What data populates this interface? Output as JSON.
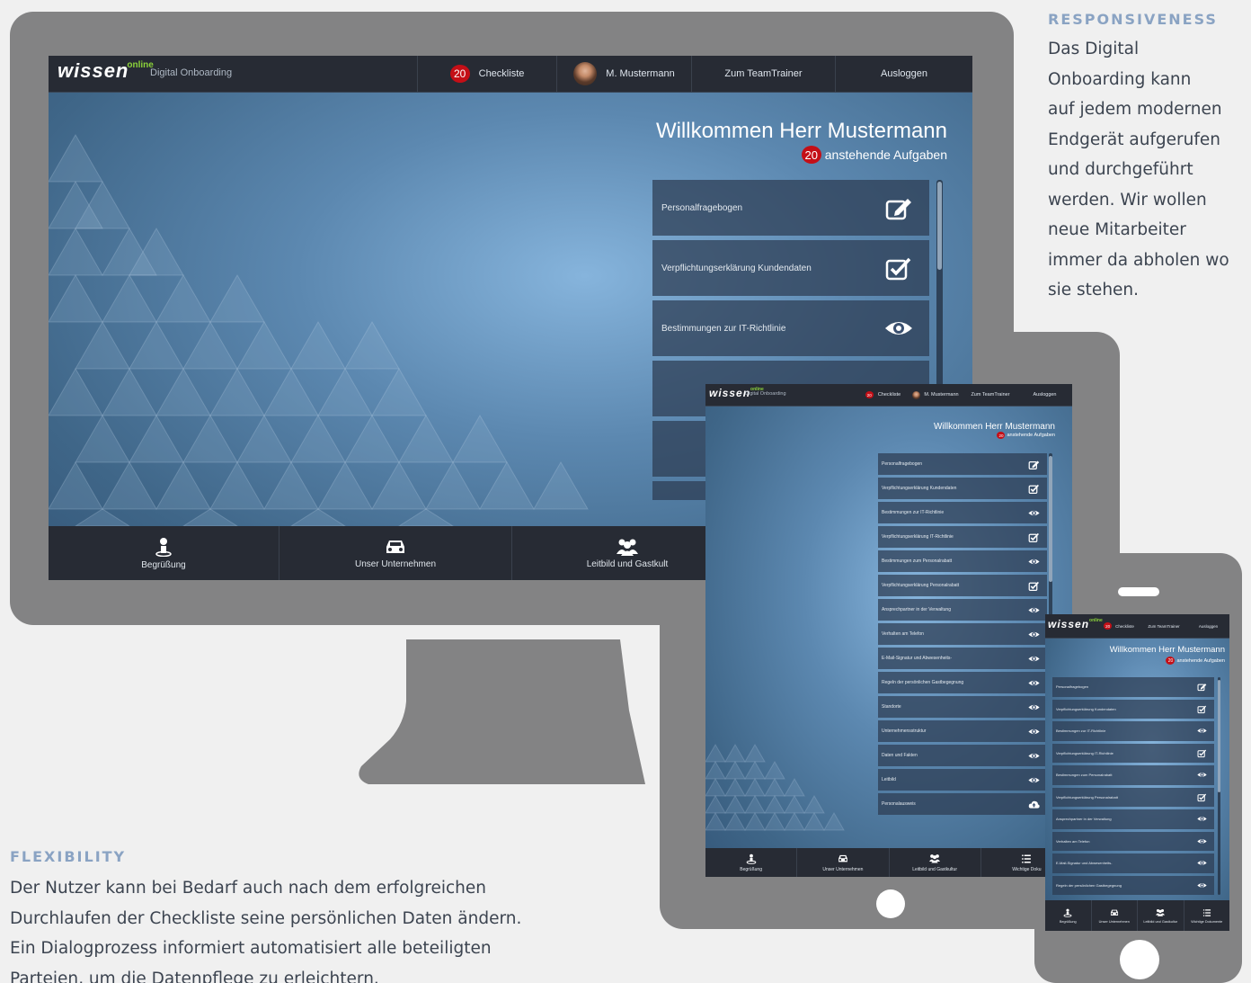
{
  "app": {
    "logo_brand": "wissen",
    "logo_sub": "online",
    "product": "Digital Onboarding",
    "badge_count": "20",
    "checklist_label": "Checkliste",
    "user_name": "M. Mustermann",
    "teamtrainer_label": "Zum TeamTrainer",
    "logout_label": "Ausloggen",
    "welcome_title": "Willkommen Herr Mustermann",
    "pending_label": "anstehende Aufgaben",
    "tasks": [
      {
        "label": "Personalfragebogen",
        "icon": "edit-icon"
      },
      {
        "label": "Verpflichtungserklärung Kundendaten",
        "icon": "check-square-icon"
      },
      {
        "label": "Bestimmungen zur IT-Richtlinie",
        "icon": "eye-icon"
      },
      {
        "label": "Verpflichtungserklärung IT-Richtlinie",
        "icon": "check-square-icon"
      },
      {
        "label": "Bestimmungen zum Personalrabatt",
        "icon": "eye-icon"
      },
      {
        "label": "Verpflichtungserklärung Personalrabatt",
        "icon": "check-square-icon"
      },
      {
        "label": "Ansprechpartner in der Verwaltung",
        "icon": "eye-icon"
      },
      {
        "label": "Verhalten am Telefon",
        "icon": "eye-icon"
      },
      {
        "label": "E-Mail-Signatur und Abwesenheits-",
        "icon": "eye-icon"
      },
      {
        "label": "Regeln der persönlichen Gastbegegnung",
        "icon": "eye-icon"
      },
      {
        "label": "Standorte",
        "icon": "eye-icon"
      },
      {
        "label": "Unternehmensstruktur",
        "icon": "eye-icon"
      },
      {
        "label": "Daten und Fakten",
        "icon": "eye-icon"
      },
      {
        "label": "Leitbild",
        "icon": "eye-icon"
      },
      {
        "label": "Personalausweis",
        "icon": "cloud-upload-icon"
      }
    ],
    "bottom_nav": [
      {
        "label": "Begrüßung",
        "icon": "person-pin-icon"
      },
      {
        "label": "Unser Unternehmen",
        "icon": "car-icon"
      },
      {
        "label": "Leitbild und Gastkultur",
        "icon": "group-icon"
      },
      {
        "label": "Wichtige Dokumente",
        "icon": "list-icon"
      }
    ],
    "desktop_bottom_nav": [
      "Begrüßung",
      "Unser Unternehmen",
      "Leitbild und Gastkult"
    ],
    "tablet_bottom_last": "Wichtige Doku"
  },
  "sidebar": {
    "heading": "RESPONSIVENESS",
    "lines": [
      "Das Digital",
      "Onboarding kann",
      "auf jedem modernen",
      "Endgerät aufgerufen",
      "und durchgeführt",
      "werden. Wir wollen",
      "neue Mitarbeiter",
      "immer da abholen wo",
      "sie stehen."
    ]
  },
  "flexibility": {
    "heading": "FLEXIBILITY",
    "lines": [
      "Der Nutzer kann bei Bedarf auch nach dem erfolgreichen",
      "Durchlaufen der Checkliste seine persönlichen Daten ändern.",
      "Ein Dialogprozess informiert automatisiert alle beteiligten",
      "Parteien, um die Datenpflege zu erleichtern."
    ]
  },
  "colors": {
    "accent_heading": "#8aa3c3",
    "badge": "#c40f17",
    "device": "#838384",
    "bar": "#272b34",
    "logo_green": "#8bd23a"
  }
}
